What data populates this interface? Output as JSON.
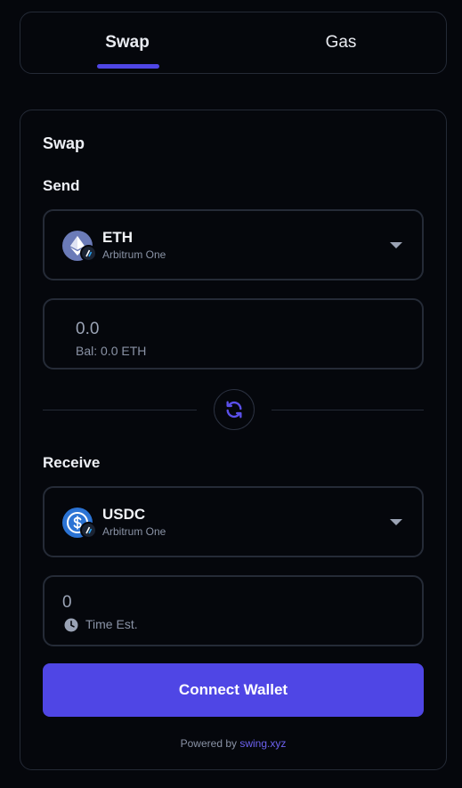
{
  "tabs": {
    "swap_label": "Swap",
    "gas_label": "Gas",
    "active": "Swap"
  },
  "card": {
    "title": "Swap",
    "send": {
      "label": "Send",
      "token_symbol": "ETH",
      "token_chain": "Arbitrum One",
      "token_icon": "eth-icon",
      "amount_placeholder": "0.0",
      "balance": "Bal: 0.0 ETH"
    },
    "swap_direction_icon": "refresh-icon",
    "receive": {
      "label": "Receive",
      "token_symbol": "USDC",
      "token_chain": "Arbitrum One",
      "token_icon": "usdc-icon",
      "amount": "0",
      "time_est": "Time Est."
    },
    "connect_button": "Connect Wallet",
    "powered_by_prefix": "Powered by",
    "powered_by_link": "swing.xyz"
  },
  "colors": {
    "background": "#05070c",
    "border": "#242a36",
    "accent": "#4f46e5",
    "link": "#6d62f0",
    "muted_text": "#8a93a6"
  }
}
